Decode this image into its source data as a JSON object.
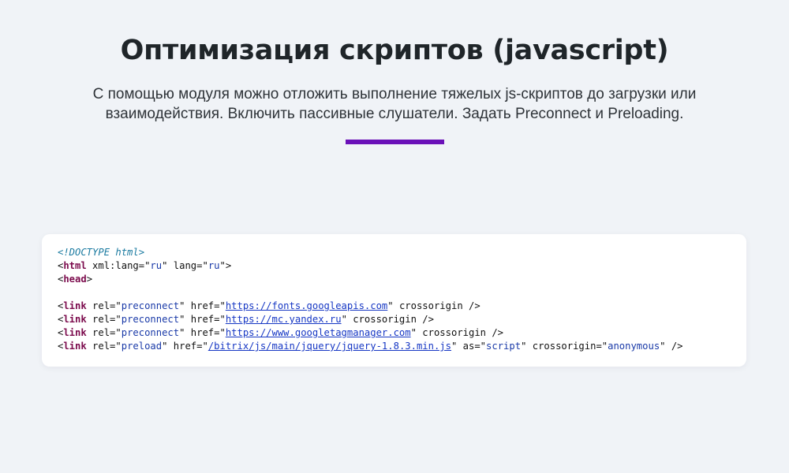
{
  "header": {
    "title": "Оптимизация скриптов (javascript)",
    "description": "С помощью модуля можно отложить выполнение тяжелых js-скриптов до загрузки или взаимодействия. Включить пассивные слушатели. Задать Preconnect и Preloading."
  },
  "colors": {
    "background": "#f0f3f7",
    "accent": "#6a10b8",
    "code_tag": "#7b0a4c",
    "code_value": "#1a3aa8",
    "code_link": "#1637c4",
    "code_doctype": "#1a7aa0"
  },
  "code": {
    "lines": [
      {
        "tokens": [
          {
            "t": "doctype",
            "v": "<!DOCTYPE html>"
          }
        ]
      },
      {
        "tokens": [
          {
            "t": "punct",
            "v": "<"
          },
          {
            "t": "tag",
            "v": "html"
          },
          {
            "t": "attr",
            "v": " xml:lang=\""
          },
          {
            "t": "val",
            "v": "ru"
          },
          {
            "t": "attr",
            "v": "\" lang=\""
          },
          {
            "t": "val",
            "v": "ru"
          },
          {
            "t": "punct",
            "v": "\">"
          }
        ]
      },
      {
        "tokens": [
          {
            "t": "punct",
            "v": "<"
          },
          {
            "t": "tag",
            "v": "head"
          },
          {
            "t": "punct",
            "v": ">"
          }
        ]
      },
      {
        "tokens": []
      },
      {
        "tokens": [
          {
            "t": "punct",
            "v": "<"
          },
          {
            "t": "tag",
            "v": "link"
          },
          {
            "t": "attr",
            "v": " rel=\""
          },
          {
            "t": "val",
            "v": "preconnect"
          },
          {
            "t": "attr",
            "v": "\" href=\""
          },
          {
            "t": "link",
            "v": "https://fonts.googleapis.com"
          },
          {
            "t": "attr",
            "v": "\" crossorigin />"
          }
        ]
      },
      {
        "tokens": [
          {
            "t": "punct",
            "v": "<"
          },
          {
            "t": "tag",
            "v": "link"
          },
          {
            "t": "attr",
            "v": " rel=\""
          },
          {
            "t": "val",
            "v": "preconnect"
          },
          {
            "t": "attr",
            "v": "\" href=\""
          },
          {
            "t": "link",
            "v": "https://mc.yandex.ru"
          },
          {
            "t": "attr",
            "v": "\" crossorigin />"
          }
        ]
      },
      {
        "tokens": [
          {
            "t": "punct",
            "v": "<"
          },
          {
            "t": "tag",
            "v": "link"
          },
          {
            "t": "attr",
            "v": " rel=\""
          },
          {
            "t": "val",
            "v": "preconnect"
          },
          {
            "t": "attr",
            "v": "\" href=\""
          },
          {
            "t": "link",
            "v": "https://www.googletagmanager.com"
          },
          {
            "t": "attr",
            "v": "\" crossorigin />"
          }
        ]
      },
      {
        "tokens": [
          {
            "t": "punct",
            "v": "<"
          },
          {
            "t": "tag",
            "v": "link"
          },
          {
            "t": "attr",
            "v": " rel=\""
          },
          {
            "t": "val",
            "v": "preload"
          },
          {
            "t": "attr",
            "v": "\" href=\""
          },
          {
            "t": "link",
            "v": "/bitrix/js/main/jquery/jquery-1.8.3.min.js"
          },
          {
            "t": "attr",
            "v": "\" as=\""
          },
          {
            "t": "val",
            "v": "script"
          },
          {
            "t": "attr",
            "v": "\" crossorigin=\""
          },
          {
            "t": "val",
            "v": "anonymous"
          },
          {
            "t": "attr",
            "v": "\" />"
          }
        ]
      }
    ]
  }
}
